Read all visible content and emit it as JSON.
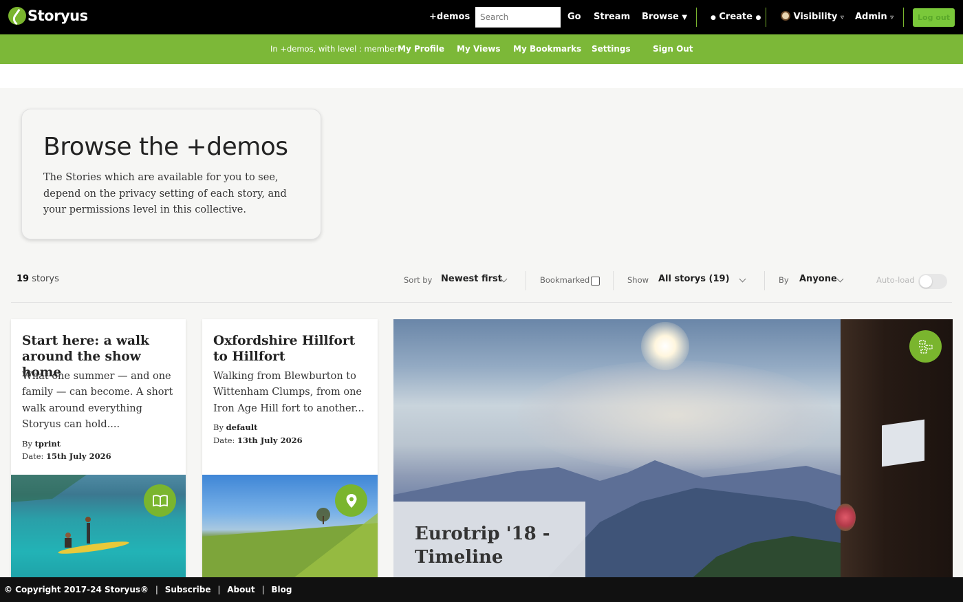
{
  "app": {
    "name": "Storyus"
  },
  "topbar": {
    "collective": "+demos",
    "search_placeholder": "Search",
    "go_label": "Go",
    "stream_label": "Stream",
    "browse_label": "Browse",
    "create_label": "Create",
    "visibility_label": "Visibility",
    "admin_label": "Admin",
    "login_label": "Log out"
  },
  "subbar": {
    "status": "In +demos, with level : member",
    "items": [
      "My Profile",
      "My Views",
      "My Bookmarks",
      "Settings",
      "Sign Out"
    ]
  },
  "intro": {
    "title": "Browse the +demos",
    "text": "The Stories which are available for you to see, depend on the privacy setting of each story, and your permissions level in this collective."
  },
  "filters": {
    "count_number": "19",
    "count_label": "storys",
    "sort_label": "Sort by",
    "sort_value": "Newest first",
    "bookmarked_label": "Bookmarked",
    "bookmarked_checked": false,
    "show_label": "Show",
    "show_value": "All storys (19)",
    "by_label": "By",
    "by_value": "Anyone",
    "autoload_label": "Auto-load",
    "autoload_on": false
  },
  "stories": [
    {
      "title": "Start here: a walk around the show home",
      "description": "What one summer — and one family — can become. A short walk around everything Storyus can hold....",
      "author_label": "By",
      "author": "tprint",
      "date_label": "Date:",
      "date": "15th July 2026",
      "icon": "book-icon"
    },
    {
      "title": "Oxfordshire Hillfort to Hillfort",
      "description": "Walking from Blewburton to Wittenham Clumps, from one Iron Age Hill fort to another...",
      "author_label": "By",
      "author": "default",
      "date_label": "Date:",
      "date": "13th July 2026",
      "icon": "map-pin-icon"
    },
    {
      "title": "Eurotrip '18 - Timeline",
      "icon": "timeline-icon"
    }
  ],
  "footer": {
    "copyright": "© Copyright 2017-24 Storyus®",
    "links": [
      "Subscribe",
      "About",
      "Blog"
    ]
  },
  "colors": {
    "brand_green": "#7cb838",
    "topbar_bg": "#000000",
    "footer_bg": "#111111"
  }
}
